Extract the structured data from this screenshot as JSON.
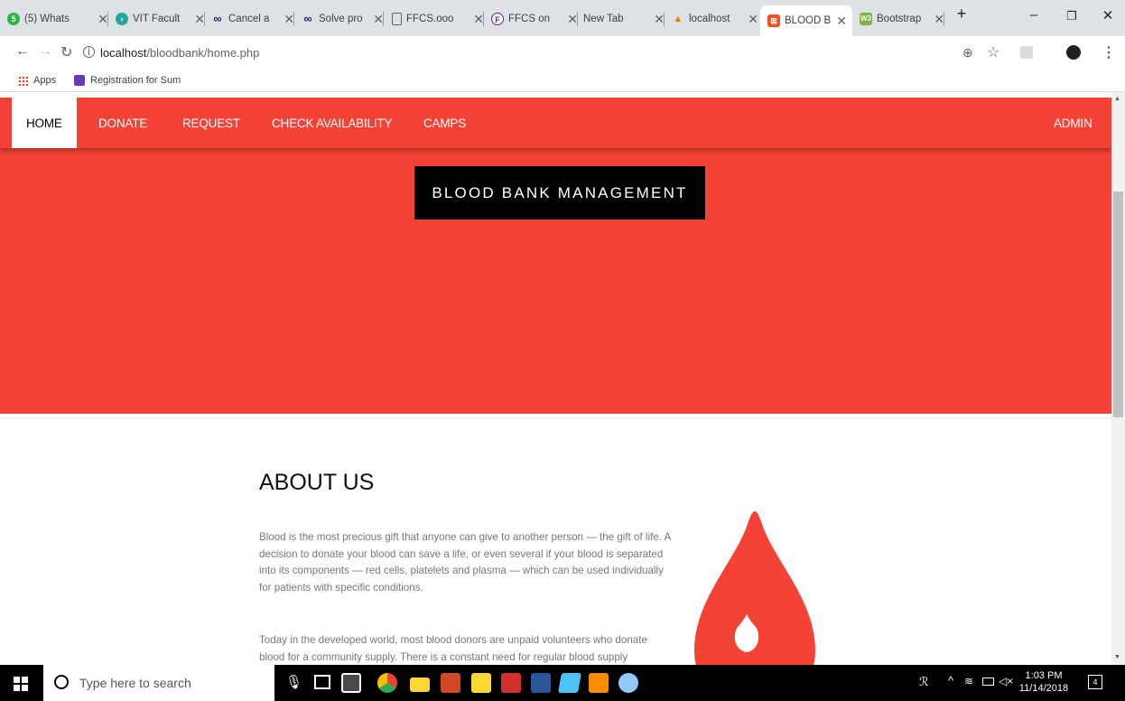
{
  "browser": {
    "tabs": [
      {
        "title": "(5) Whats",
        "color": "#2ab540"
      },
      {
        "title": "VIT Facult",
        "color": "#26a69a"
      },
      {
        "title": "Cancel a",
        "color": "#1a237e"
      },
      {
        "title": "Solve pro",
        "color": "#1a237e"
      },
      {
        "title": "FFCS.ooo",
        "color": "#9aa0a6"
      },
      {
        "title": "FFCS on",
        "color": "#6a1b9a"
      },
      {
        "title": "New Tab",
        "color": ""
      },
      {
        "title": "localhost",
        "color": "#f57c00"
      },
      {
        "title": "BLOOD B",
        "color": "#f4511e"
      },
      {
        "title": "Bootstrap",
        "color": "#7cb342"
      }
    ],
    "url_host": "localhost",
    "url_path": "/bloodbank/home.php",
    "bookmarks": [
      {
        "label": "Apps"
      },
      {
        "label": "Registration for Sum"
      }
    ]
  },
  "nav": {
    "home": "HOME",
    "donate": "DONATE",
    "request": "REQUEST",
    "check": "CHECK AVAILABILITY",
    "camps": "CAMPS",
    "admin": "ADMIN"
  },
  "hero": {
    "title": "BLOOD BANK MANAGEMENT",
    "color": "#f44336"
  },
  "about": {
    "heading": "ABOUT US",
    "para1": "Blood is the most precious gift that anyone can give to another person — the gift of life. A decision to donate your blood can save a life, or even several if your blood is separated into its components — red cells, platelets and plasma — which can be used individually for patients with specific conditions.",
    "para2": "Today in the developed world, most blood donors are unpaid volunteers who donate blood for a community supply. There is a constant need for regular blood supply"
  },
  "taskbar": {
    "search_placeholder": "Type here to search",
    "time": "1:03 PM",
    "date": "11/14/2018",
    "notifications": "4"
  }
}
